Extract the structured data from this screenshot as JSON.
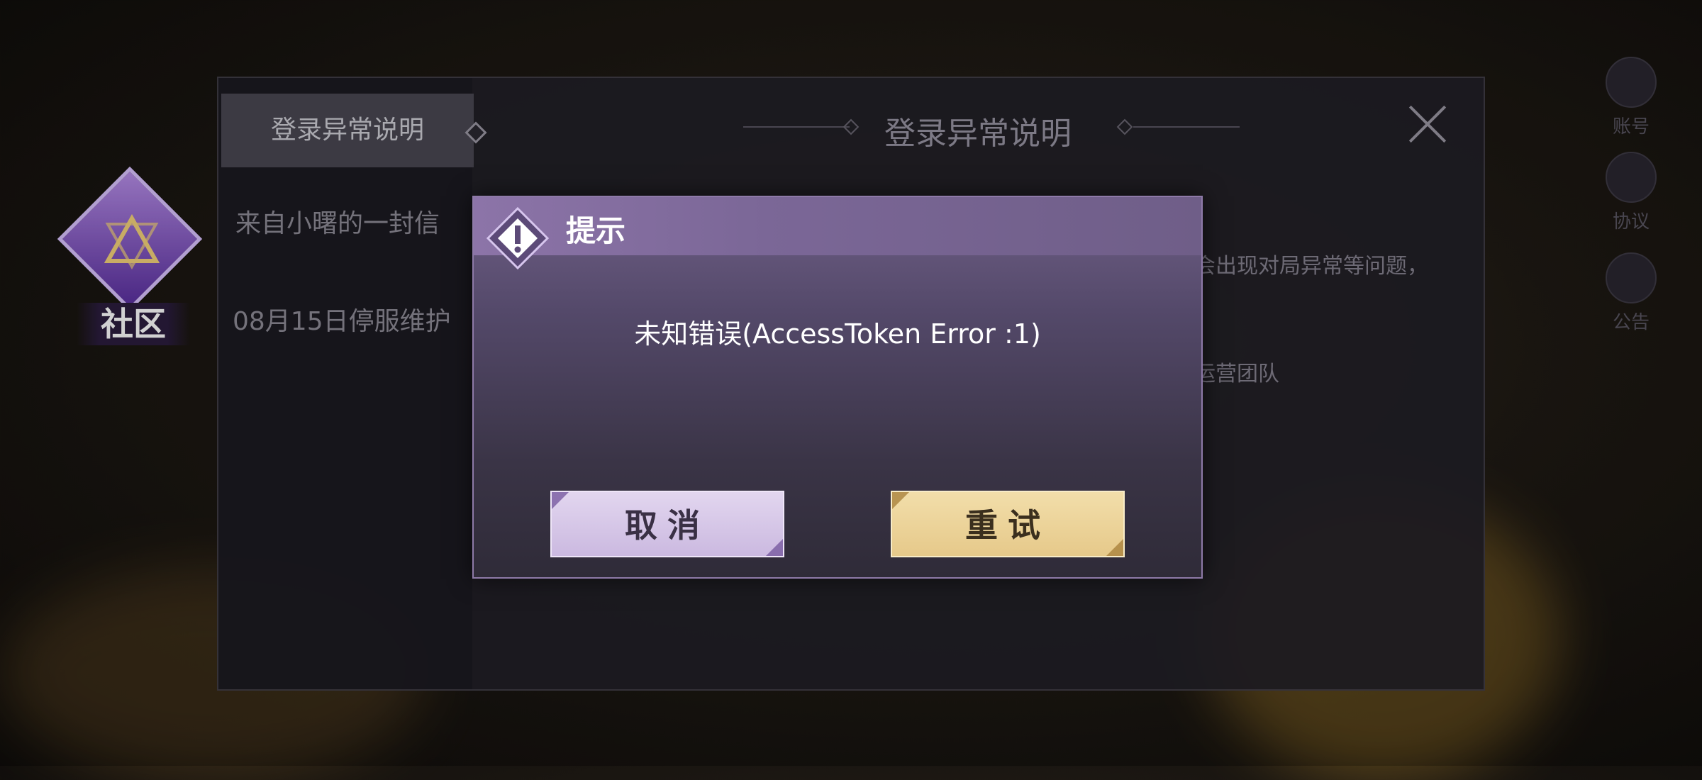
{
  "community": {
    "label": "社区"
  },
  "notice_panel": {
    "title": "登录异常说明",
    "side_tabs": [
      {
        "label": "登录异常说明"
      },
      {
        "label": "来自小曙的一封信"
      },
      {
        "label": "08月15日停服维护"
      }
    ],
    "body_fragments": [
      "会出现对局异常等问题，",
      "运营团队"
    ]
  },
  "right_icons": [
    {
      "label": "账号",
      "icon": "account-icon"
    },
    {
      "label": "协议",
      "icon": "document-icon"
    },
    {
      "label": "公告",
      "icon": "megaphone-icon"
    }
  ],
  "dialog": {
    "title": "提示",
    "message": "未知错误(AccessToken Error :1)",
    "cancel_label": "取消",
    "retry_label": "重试"
  },
  "colors": {
    "dialog_header": "#7b6797",
    "cancel_button": "#d8c9ea",
    "retry_button": "#ecd398"
  }
}
